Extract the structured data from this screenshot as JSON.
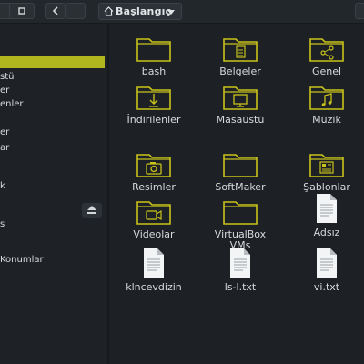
{
  "toolbar": {
    "location": "Başlangıç"
  },
  "sidebar": {
    "items": [
      {
        "label": "",
        "selected": true
      },
      {
        "label": "stü"
      },
      {
        "label": "er"
      },
      {
        "label": "enler"
      },
      {
        "label": "er"
      },
      {
        "label": "ar"
      },
      {
        "label": "k"
      },
      {
        "label": "s"
      },
      {
        "label": "Konumlar"
      }
    ]
  },
  "files": [
    {
      "name": "bash",
      "type": "folder",
      "emblem": "none"
    },
    {
      "name": "Belgeler",
      "type": "folder",
      "emblem": "document"
    },
    {
      "name": "Genel",
      "type": "folder",
      "emblem": "share"
    },
    {
      "name": "İndirilenler",
      "type": "folder",
      "emblem": "download"
    },
    {
      "name": "Masaüstü",
      "type": "folder",
      "emblem": "desktop"
    },
    {
      "name": "Müzik",
      "type": "folder",
      "emblem": "music"
    },
    {
      "name": "Resimler",
      "type": "folder",
      "emblem": "camera"
    },
    {
      "name": "SoftMaker",
      "type": "folder",
      "emblem": "none"
    },
    {
      "name": "Şablonlar",
      "type": "folder",
      "emblem": "template"
    },
    {
      "name": "Videolar",
      "type": "folder",
      "emblem": "video"
    },
    {
      "name": "VirtualBox VMs",
      "type": "folder",
      "emblem": "none"
    },
    {
      "name": "Adsız",
      "type": "text-file"
    },
    {
      "name": "klncevdizin",
      "type": "text-file"
    },
    {
      "name": "ls-l.txt",
      "type": "text-file"
    },
    {
      "name": "vi.txt",
      "type": "text-file"
    }
  ],
  "colors": {
    "accent": "#c8c21a",
    "background": "#1d2125"
  }
}
